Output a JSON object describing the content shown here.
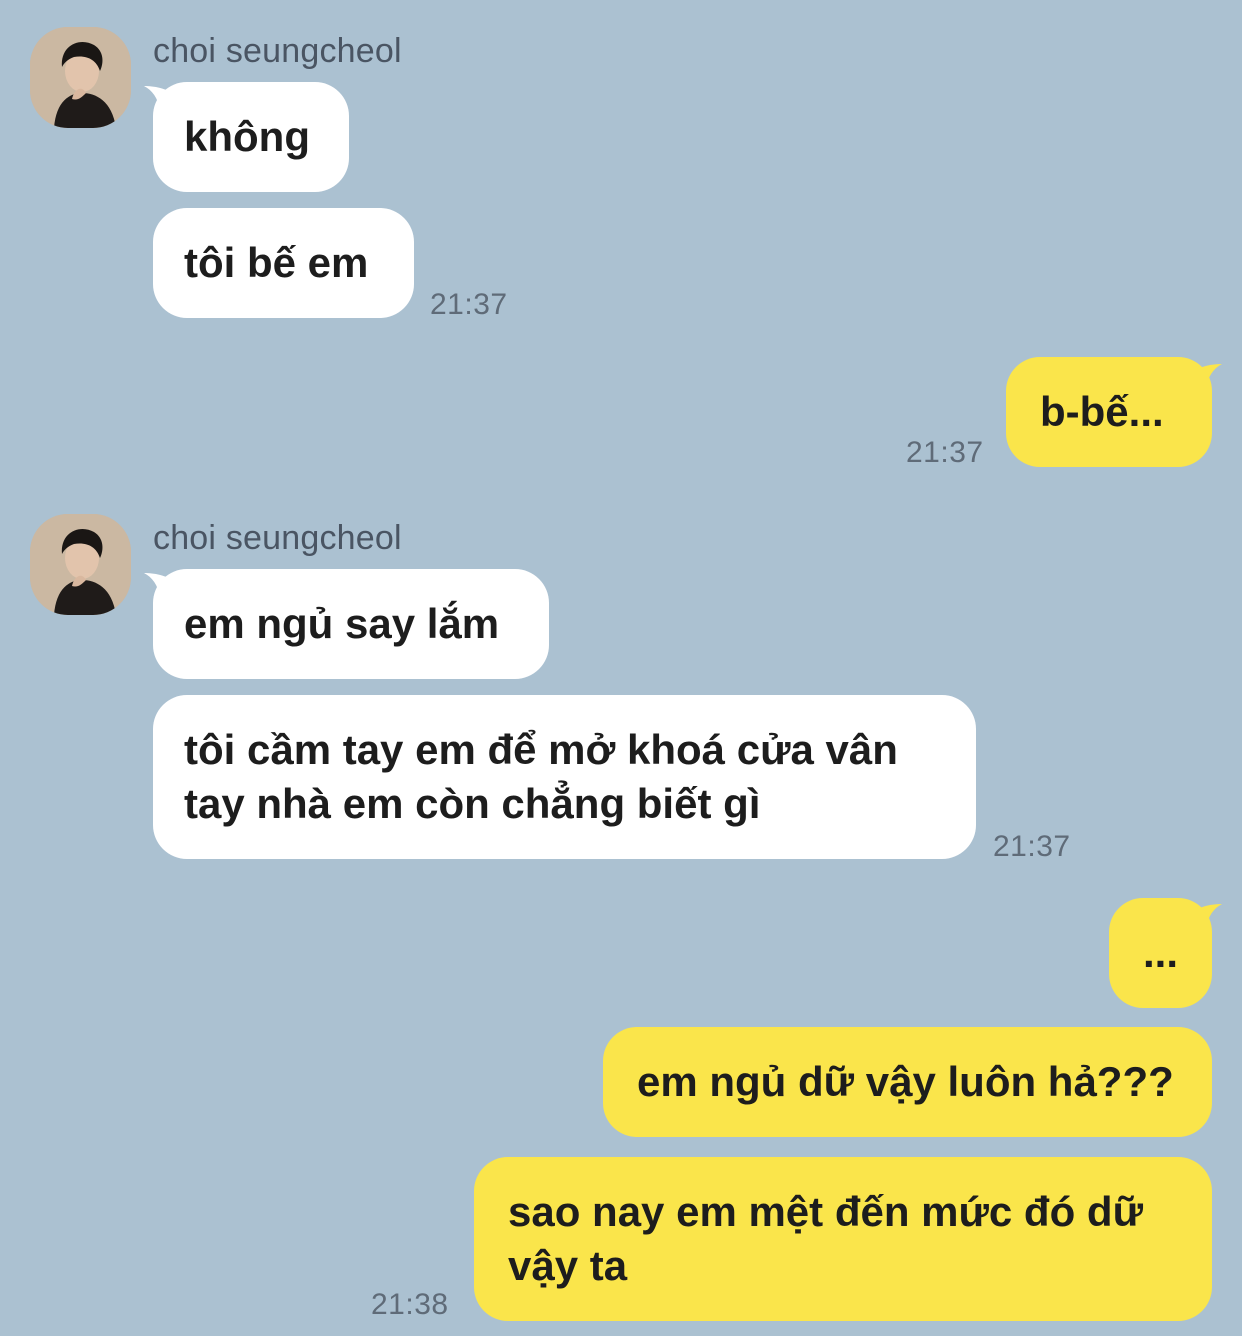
{
  "colors": {
    "background": "#abc1d1",
    "incoming_bubble": "#ffffff",
    "outgoing_bubble": "#fae54b",
    "text": "#1d1d1d",
    "timestamp": "#5f6b78",
    "sender_name": "#4a5563"
  },
  "groups": [
    {
      "sender": "choi seungcheol",
      "messages": [
        "không",
        "tôi bế em"
      ],
      "time": "21:37"
    },
    {
      "outgoing": true,
      "messages": [
        "b-bế..."
      ],
      "time": "21:37"
    },
    {
      "sender": "choi seungcheol",
      "messages": [
        "em ngủ say lắm",
        "tôi cầm tay em để mở khoá cửa vân",
        "tay nhà em còn chẳng biết gì"
      ],
      "time": "21:37"
    },
    {
      "outgoing": true,
      "messages": [
        "...",
        "em ngủ dữ vậy luôn hả???",
        "sao nay em mệt đến mức đó dữ",
        "vậy ta"
      ],
      "time": "21:38"
    }
  ]
}
